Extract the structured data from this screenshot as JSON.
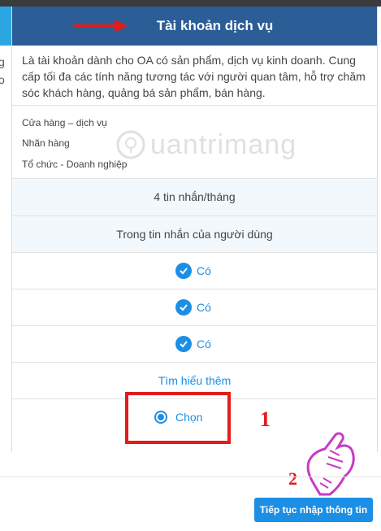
{
  "header": {
    "title": "Tài khoản dịch vụ"
  },
  "left_column": {
    "text_line1": "g",
    "text_line2": "o"
  },
  "description": "Là tài khoản dành cho OA có sản phẩm, dịch vụ kinh doanh. Cung cấp tối đa các tính năng tương tác với người quan tâm, hỗ trợ chăm sóc khách hàng, quảng bá sản phẩm, bán hàng.",
  "categories": [
    "Cửa hàng – dịch vụ",
    "Nhãn hàng",
    "Tổ chức - Doanh nghiệp"
  ],
  "messages_per_month": "4 tin nhắn/tháng",
  "message_scope": "Trong tin nhắn của người dùng",
  "features": [
    {
      "label": "Có"
    },
    {
      "label": "Có"
    },
    {
      "label": "Có"
    }
  ],
  "learn_more": "Tìm hiểu thêm",
  "select_option": {
    "label": "Chọn",
    "selected": true
  },
  "annotations": {
    "step1": "1",
    "step2": "2"
  },
  "watermark": "uantrimang",
  "continue_button": "Tiếp tục nhập thông tin",
  "colors": {
    "header_bg": "#2b5d96",
    "accent_blue": "#1b8ee6",
    "left_header": "#2aa7e1",
    "highlight_red": "#e31b1b",
    "row_light": "#f2f8fc"
  }
}
